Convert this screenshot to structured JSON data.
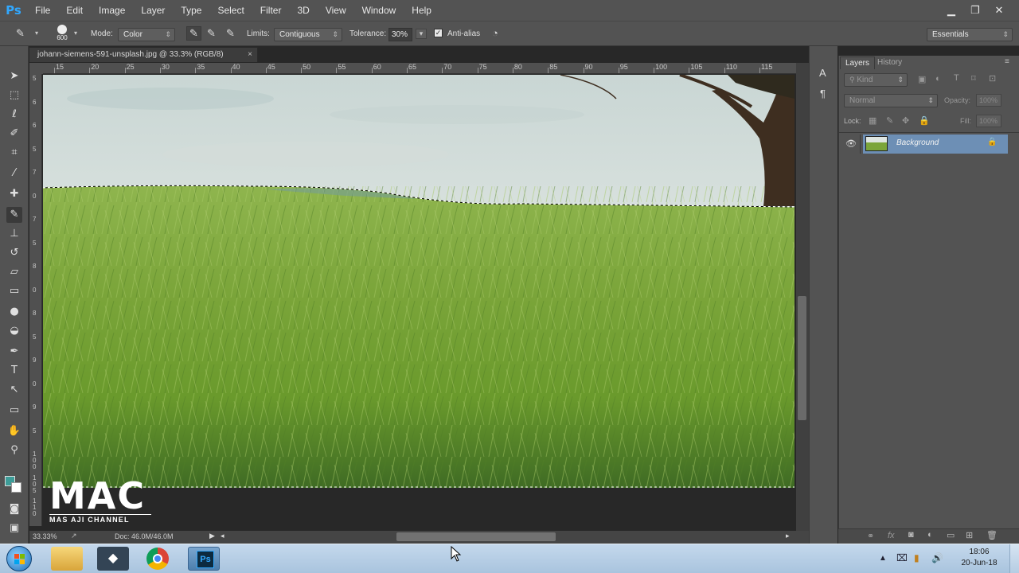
{
  "app": {
    "logo": "Ps",
    "menu": [
      "File",
      "Edit",
      "Image",
      "Layer",
      "Type",
      "Select",
      "Filter",
      "3D",
      "View",
      "Window",
      "Help"
    ],
    "window_controls": [
      "minimize-icon",
      "restore-icon",
      "close-icon"
    ]
  },
  "options": {
    "brush_size": "600",
    "mode_label": "Mode:",
    "mode_value": "Color",
    "limits_label": "Limits:",
    "limits_value": "Contiguous",
    "tolerance_label": "Tolerance:",
    "tolerance_value": "30%",
    "antialias_label": "Anti-alias",
    "antialias_checked": true,
    "workspace": "Essentials"
  },
  "document": {
    "tab_title": "johann-siemens-591-unsplash.jpg @ 33.3% (RGB/8)",
    "ruler_h": [
      "15",
      "20",
      "25",
      "30",
      "35",
      "40",
      "45",
      "50",
      "55",
      "60",
      "65",
      "70",
      "75",
      "80",
      "85",
      "90",
      "95",
      "100",
      "105",
      "110",
      "115"
    ],
    "ruler_v": [
      "5",
      "6",
      "6",
      "5",
      "7",
      "0",
      "7",
      "5",
      "8",
      "0",
      "8",
      "5",
      "9",
      "0",
      "9",
      "5",
      "1 0 0",
      "1 0 5",
      "1 1 0"
    ],
    "zoom": "33.33%",
    "doc_size": "Doc: 46.0M/46.0M"
  },
  "layers_panel": {
    "tabs": [
      "Layers",
      "History"
    ],
    "kind_filter": "Kind",
    "blend_mode": "Normal",
    "opacity_label": "Opacity:",
    "opacity_value": "100%",
    "lock_label": "Lock:",
    "fill_label": "Fill:",
    "fill_value": "100%",
    "layers": [
      {
        "name": "Background",
        "visible": true,
        "locked": true
      }
    ]
  },
  "taskbar": {
    "apps": [
      "start-icon",
      "explorer-icon",
      "vectorizer-icon",
      "chrome-icon",
      "photoshop-icon"
    ],
    "photoshop_label": "Ps",
    "time": "18:06",
    "date": "20-Jun-18"
  },
  "watermark": {
    "brand": "MAC",
    "sub": "MAS AJI CHANNEL"
  },
  "colors": {
    "ui_dark": "#535353",
    "selection_blue": "#6d8fb5",
    "ps_blue": "#31a8ff",
    "grass": "#7aa632"
  }
}
